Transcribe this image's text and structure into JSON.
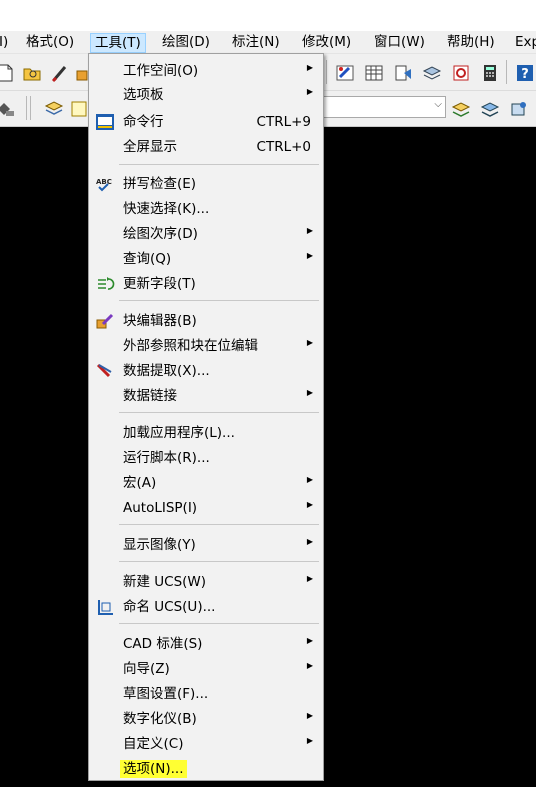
{
  "menubar": {
    "items": [
      {
        "label": "I)"
      },
      {
        "label": "格式(O)"
      },
      {
        "label": "工具(T)"
      },
      {
        "label": "绘图(D)"
      },
      {
        "label": "标注(N)"
      },
      {
        "label": "修改(M)"
      },
      {
        "label": "窗口(W)"
      },
      {
        "label": "帮助(H)"
      },
      {
        "label": "Exp"
      }
    ],
    "active_index": 2
  },
  "tools_menu": {
    "items": [
      {
        "label": "工作空间(O)",
        "submenu": true
      },
      {
        "label": "选项板",
        "submenu": true
      },
      {
        "label": "命令行",
        "shortcut": "CTRL+9",
        "icon": "command-line-icon"
      },
      {
        "label": "全屏显示",
        "shortcut": "CTRL+0"
      },
      {
        "label": "拼写检查(E)",
        "icon": "spell-check-icon"
      },
      {
        "label": "快速选择(K)..."
      },
      {
        "label": "绘图次序(D)",
        "submenu": true
      },
      {
        "label": "查询(Q)",
        "submenu": true
      },
      {
        "label": "更新字段(T)",
        "icon": "update-fields-icon"
      },
      {
        "label": "块编辑器(B)",
        "icon": "block-editor-icon"
      },
      {
        "label": "外部参照和块在位编辑",
        "submenu": true
      },
      {
        "label": "数据提取(X)...",
        "icon": "data-extraction-icon"
      },
      {
        "label": "数据链接",
        "submenu": true
      },
      {
        "label": "加载应用程序(L)..."
      },
      {
        "label": "运行脚本(R)..."
      },
      {
        "label": "宏(A)",
        "submenu": true
      },
      {
        "label": "AutoLISP(I)",
        "submenu": true
      },
      {
        "label": "显示图像(Y)",
        "submenu": true
      },
      {
        "label": "新建 UCS(W)",
        "submenu": true
      },
      {
        "label": "命名 UCS(U)...",
        "icon": "named-ucs-icon"
      },
      {
        "label": "CAD 标准(S)",
        "submenu": true
      },
      {
        "label": "向导(Z)",
        "submenu": true
      },
      {
        "label": "草图设置(F)..."
      },
      {
        "label": "数字化仪(B)",
        "submenu": true
      },
      {
        "label": "自定义(C)",
        "submenu": true
      },
      {
        "label": "选项(N)...",
        "highlighted": true
      }
    ],
    "submenu_arrow": "▶",
    "highlight_color": "#ffff33"
  },
  "toolbar": {
    "combo_arrow": "⌵"
  },
  "colors": {
    "canvas": "#000000",
    "menu_bg": "#f2f2f2",
    "active_menu": "#cce8ff"
  }
}
